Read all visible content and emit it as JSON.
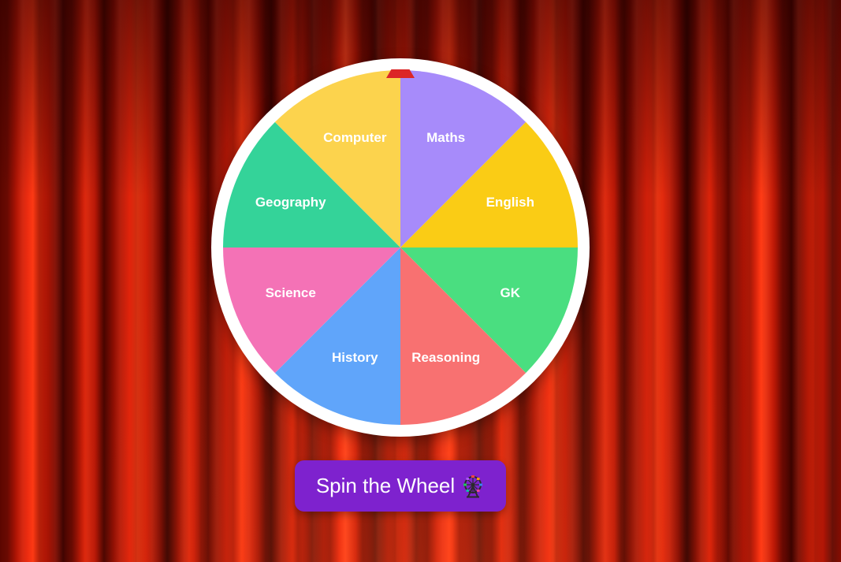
{
  "wheel": {
    "segments": [
      {
        "label": "Maths",
        "color": "#a78bfa"
      },
      {
        "label": "English",
        "color": "#facc15"
      },
      {
        "label": "GK",
        "color": "#4ade80"
      },
      {
        "label": "Reasoning",
        "color": "#f87171"
      },
      {
        "label": "History",
        "color": "#60a5fa"
      },
      {
        "label": "Science",
        "color": "#f472b6"
      },
      {
        "label": "Geography",
        "color": "#34d399"
      },
      {
        "label": "Computer",
        "color": "#fcd34d"
      }
    ],
    "pointer_color": "#dc2626",
    "rim_color": "#ffffff"
  },
  "spin_button": {
    "label": "Spin the Wheel",
    "icon": "ferris-wheel-icon",
    "background": "#7e22ce"
  },
  "background": {
    "style": "red-theater-curtain"
  }
}
